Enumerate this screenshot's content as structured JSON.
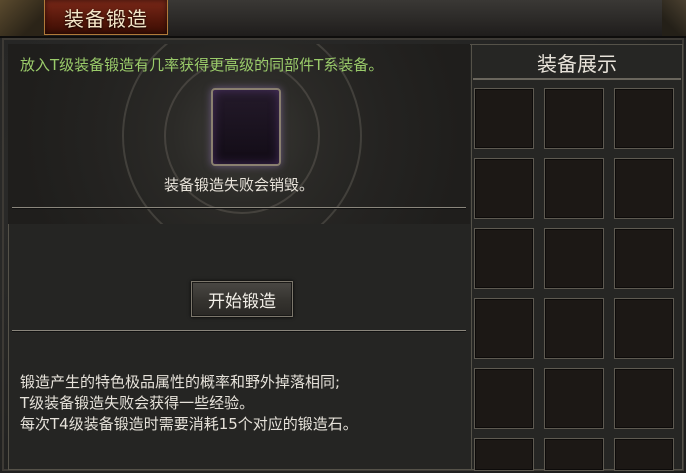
{
  "window": {
    "title": "装备锻造"
  },
  "forge": {
    "hint_top": "放入T级装备锻造有几率获得更高级的同部件T系装备。",
    "slot_hint": "装备锻造失败会销毁。",
    "button_label": "开始锻造",
    "notes": [
      "锻造产生的特色极品属性的概率和野外掉落相同;",
      "T级装备锻造失败会获得一些经验。",
      "每次T4级装备锻造时需要消耗15个对应的锻造石。"
    ]
  },
  "showcase": {
    "title": "装备展示",
    "columns": 3,
    "rows": 6
  },
  "colors": {
    "hint_green": "#9acb6a",
    "title_tab_red": "#7a2818",
    "slot_glow": "#8a60b0"
  }
}
